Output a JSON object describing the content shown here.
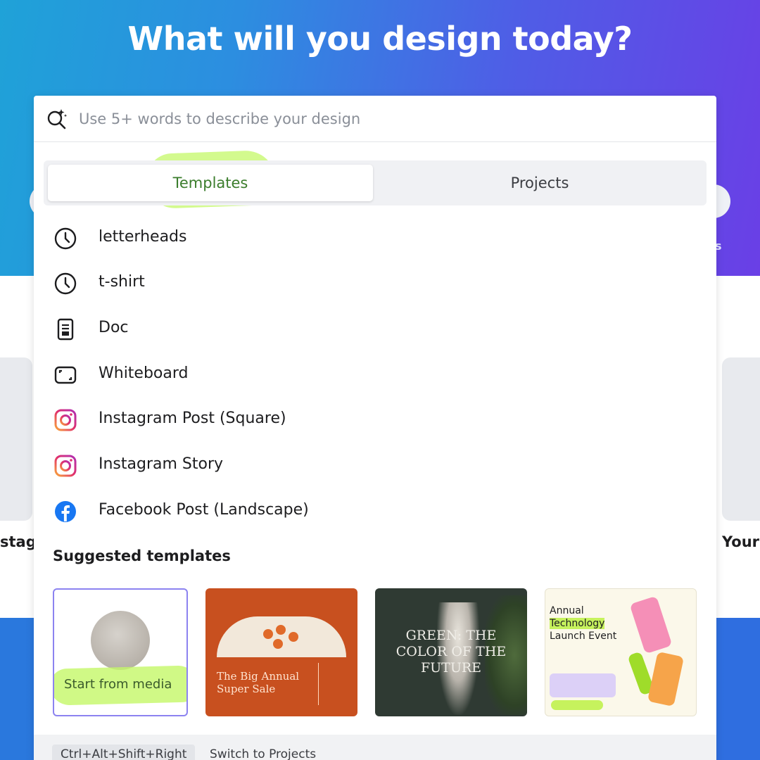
{
  "hero": {
    "title": "What will you design today?"
  },
  "background": {
    "left_label": "stag",
    "right_label": "Your",
    "right_fragment": "s"
  },
  "search": {
    "placeholder": "Use 5+ words to describe your design",
    "value": ""
  },
  "tabs": [
    {
      "label": "Templates",
      "active": true
    },
    {
      "label": "Projects",
      "active": false
    }
  ],
  "recent_list": [
    {
      "label": "letterheads",
      "icon": "clock-icon"
    },
    {
      "label": "t-shirt",
      "icon": "clock-icon"
    },
    {
      "label": "Doc",
      "icon": "doc-icon"
    },
    {
      "label": "Whiteboard",
      "icon": "whiteboard-icon"
    },
    {
      "label": "Instagram Post (Square)",
      "icon": "instagram-icon"
    },
    {
      "label": "Instagram Story",
      "icon": "instagram-icon"
    },
    {
      "label": "Facebook Post (Landscape)",
      "icon": "facebook-icon"
    }
  ],
  "suggested": {
    "title": "Suggested templates",
    "cards": [
      {
        "label": "Start from media"
      },
      {
        "title_line1": "The Big Annual",
        "title_line2": "Super Sale"
      },
      {
        "title_line1": "GREEN: THE",
        "title_line2": "COLOR OF THE",
        "title_line3": "FUTURE"
      },
      {
        "title_line1": "Annual",
        "title_line2": "Technology",
        "title_line3": "Launch Event"
      }
    ]
  },
  "footer": {
    "shortcut": "Ctrl+Alt+Shift+Right",
    "hint": "Switch to Projects"
  },
  "colors": {
    "hero_start": "#1fa2d8",
    "hero_end": "#6a3fe6",
    "highlight": "#c4f868",
    "facebook": "#1877f2",
    "instagram": "#e1306c"
  }
}
